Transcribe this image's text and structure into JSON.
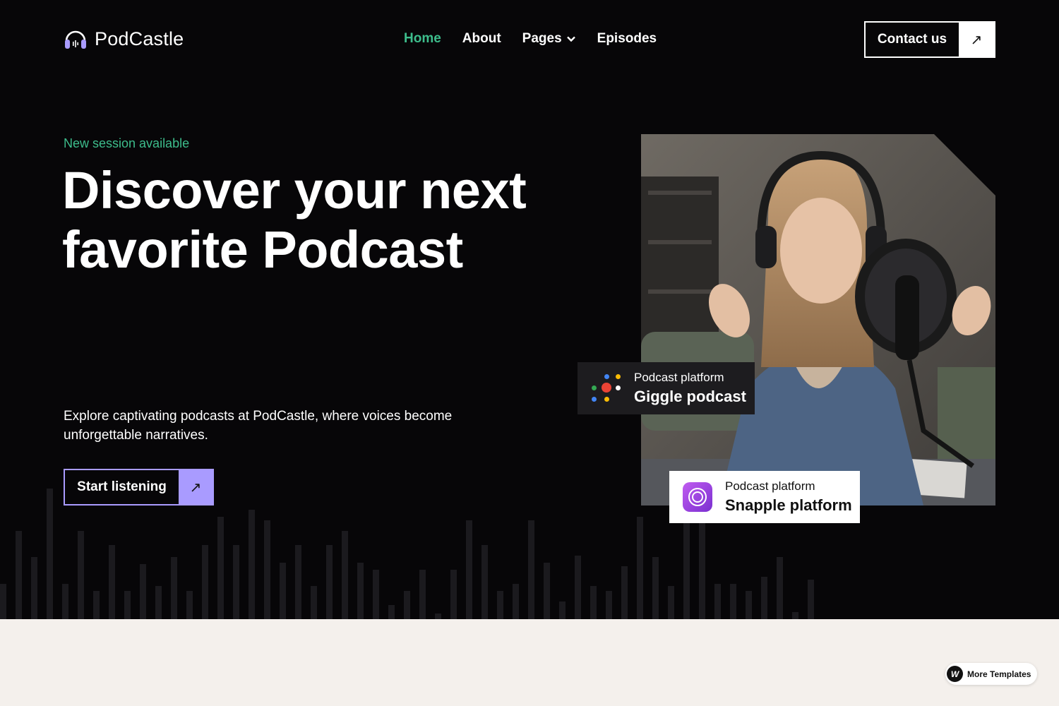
{
  "brand": {
    "name": "PodCastle",
    "logo_icon": "headphones-icon"
  },
  "nav": {
    "items": [
      {
        "label": "Home",
        "active": true
      },
      {
        "label": "About",
        "active": false
      },
      {
        "label": "Pages",
        "active": false,
        "has_dropdown": true
      },
      {
        "label": "Episodes",
        "active": false
      }
    ]
  },
  "contact_button": {
    "label": "Contact us",
    "icon": "arrow-up-right-icon"
  },
  "hero": {
    "eyebrow": "New session available",
    "headline_line1": "Discover your next",
    "headline_line2": "favorite Podcast",
    "description": "Explore captivating podcasts at PodCastle, where voices become unforgettable narratives.",
    "cta_label": "Start listening",
    "cta_icon": "arrow-up-right-icon"
  },
  "cards": [
    {
      "small": "Podcast platform",
      "big": "Giggle podcast",
      "icon": "google-podcasts-dots-icon"
    },
    {
      "small": "Podcast platform",
      "big": "Snapple platform",
      "icon": "apple-podcasts-icon"
    }
  ],
  "badge": {
    "label": "More Templates",
    "icon": "webflow-icon"
  },
  "colors": {
    "background_dark": "#070608",
    "accent_green": "#3dbd8c",
    "accent_purple": "#a99bff",
    "section_light": "#f4f0ec"
  }
}
